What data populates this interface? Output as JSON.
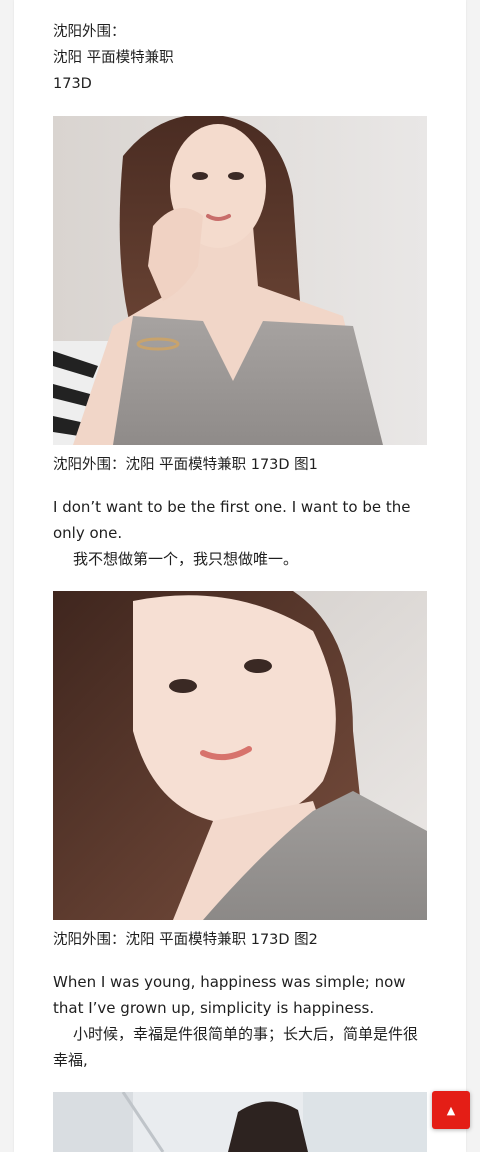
{
  "article": {
    "intro": {
      "line1": "沈阳外围：",
      "line2": "沈阳 平面模特兼职",
      "line3": "173D"
    },
    "images": [
      {
        "alt": "沈阳外围：沈阳 平面模特兼职 173D 图1",
        "caption": "沈阳外围：沈阳 平面模特兼职 173D 图1"
      },
      {
        "alt": "沈阳外围：沈阳 平面模特兼职 173D 图2",
        "caption": "沈阳外围：沈阳 平面模特兼职 173D 图2"
      },
      {
        "alt": ""
      }
    ],
    "quote1": {
      "en": "I don’t want to be the first one. I want to be the only one.",
      "cn": "我不想做第一个，我只想做唯一。"
    },
    "quote2": {
      "en": "When I was young, happiness was simple; now that I’ve grown up, simplicity is happiness.",
      "cn": "小时候，幸福是件很简单的事；长大后，简单是件很幸福,"
    }
  },
  "back_to_top": {
    "icon": "chevron-up-icon",
    "color": "#e41e16"
  }
}
